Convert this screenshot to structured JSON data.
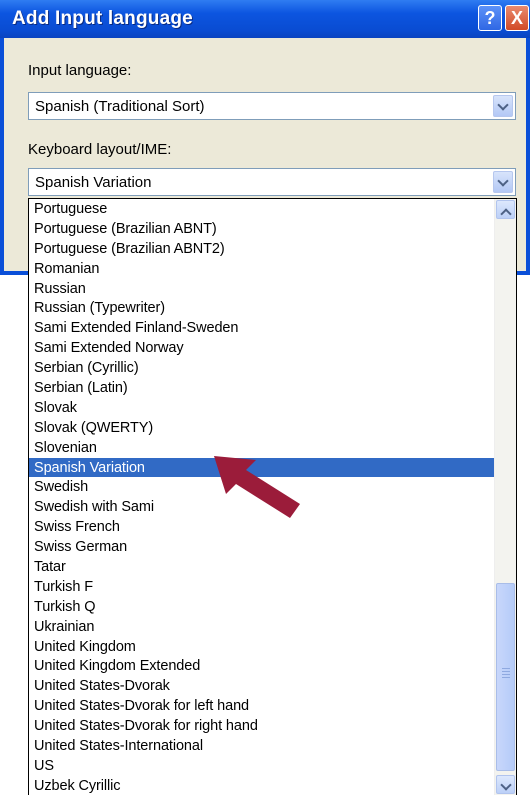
{
  "window": {
    "title": "Add Input language",
    "help_label": "?",
    "close_label": "X"
  },
  "input_language": {
    "label": "Input language:",
    "value": "Spanish (Traditional Sort)"
  },
  "keyboard_layout": {
    "label": "Keyboard layout/IME:",
    "value": "Spanish Variation"
  },
  "dropdown": {
    "selected_index": 13,
    "items": [
      "Portuguese",
      "Portuguese (Brazilian ABNT)",
      "Portuguese (Brazilian ABNT2)",
      "Romanian",
      "Russian",
      "Russian (Typewriter)",
      "Sami Extended Finland-Sweden",
      "Sami Extended Norway",
      "Serbian (Cyrillic)",
      "Serbian (Latin)",
      "Slovak",
      "Slovak (QWERTY)",
      "Slovenian",
      "Spanish Variation",
      "Swedish",
      "Swedish with Sami",
      "Swiss French",
      "Swiss German",
      "Tatar",
      "Turkish F",
      "Turkish Q",
      "Ukrainian",
      "United Kingdom",
      "United Kingdom Extended",
      "United States-Dvorak",
      "United States-Dvorak for left hand",
      "United States-Dvorak for right hand",
      "United States-International",
      "US",
      "Uzbek Cyrillic"
    ]
  },
  "colors": {
    "titlebar": "#0c55e0",
    "selection": "#316ac5",
    "dialog_bg": "#ece9d8",
    "annotation_arrow": "#9b1c3a"
  }
}
